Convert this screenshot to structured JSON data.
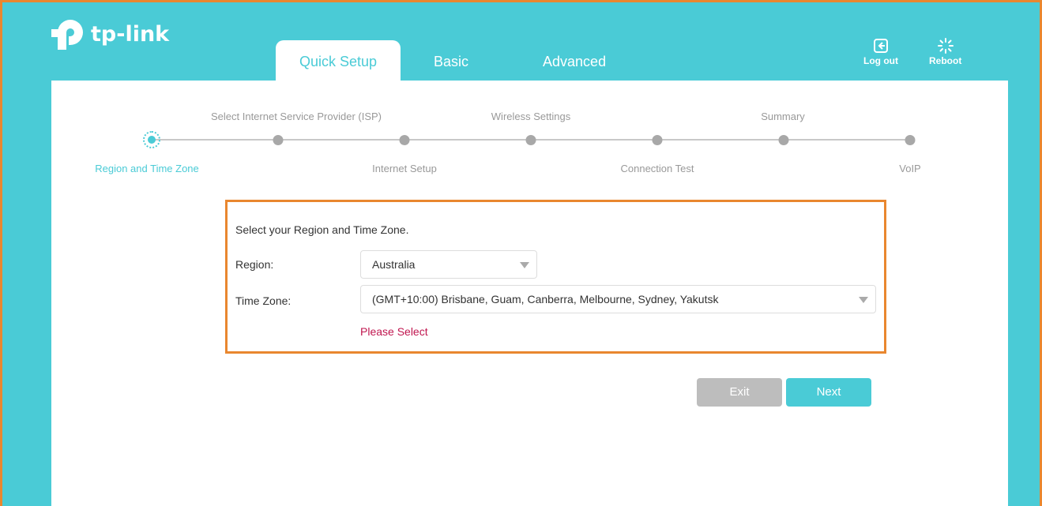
{
  "header": {
    "brand": "tp-link",
    "tabs": [
      {
        "label": "Quick Setup"
      },
      {
        "label": "Basic"
      },
      {
        "label": "Advanced"
      }
    ],
    "logout_label": "Log out",
    "reboot_label": "Reboot"
  },
  "wizard": {
    "steps_top": [
      {
        "label": "Select Internet Service Provider (ISP)"
      },
      {
        "label": "Wireless Settings"
      },
      {
        "label": "Summary"
      }
    ],
    "steps_bottom": [
      {
        "label": "Region and Time Zone"
      },
      {
        "label": "Internet Setup"
      },
      {
        "label": "Connection Test"
      },
      {
        "label": "VoIP"
      }
    ],
    "current_step": 1,
    "total_steps": 7
  },
  "form": {
    "intro": "Select your Region and Time Zone.",
    "region_label": "Region:",
    "region_value": "Australia",
    "timezone_label": "Time Zone:",
    "timezone_value": "(GMT+10:00) Brisbane, Guam, Canberra, Melbourne, Sydney, Yakutsk",
    "error": "Please Select"
  },
  "actions": {
    "exit_label": "Exit",
    "next_label": "Next"
  },
  "colors": {
    "accent": "#4acbd6",
    "highlight_border": "#e9872f",
    "error": "#c0164f",
    "exit_button": "#bdbdbd"
  }
}
